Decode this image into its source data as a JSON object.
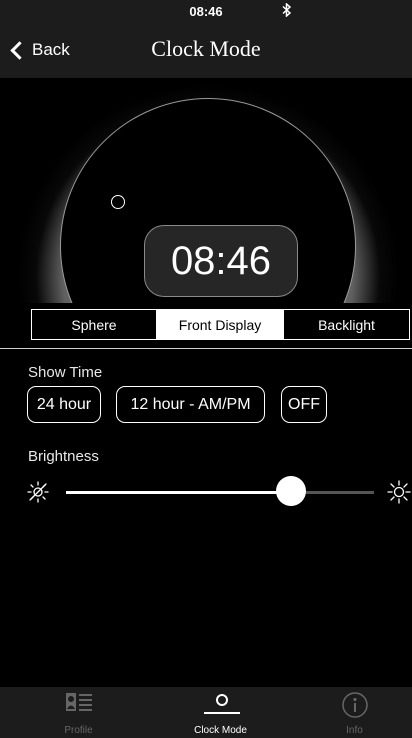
{
  "status_bar": {
    "time": "08:46",
    "bluetooth_icon": "bluetooth-icon"
  },
  "nav": {
    "back_label": "Back",
    "title": "Clock Mode"
  },
  "preview": {
    "time": "08:46"
  },
  "segments": [
    {
      "label": "Sphere",
      "selected": false
    },
    {
      "label": "Front Display",
      "selected": true
    },
    {
      "label": "Backlight",
      "selected": false
    }
  ],
  "show_time": {
    "label": "Show Time",
    "options": [
      {
        "label": "24 hour"
      },
      {
        "label": "12 hour - AM/PM"
      },
      {
        "label": "OFF"
      }
    ]
  },
  "brightness": {
    "label": "Brightness",
    "value_fraction": 0.73
  },
  "tabs": [
    {
      "label": "Profile",
      "icon": "profile-icon",
      "active": false
    },
    {
      "label": "Clock Mode",
      "icon": "clock-mode-icon",
      "active": true
    },
    {
      "label": "Info",
      "icon": "info-icon",
      "active": false
    }
  ],
  "colors": {
    "background": "#000000",
    "bar": "#1c1c1c",
    "active_tab": "#ffffff",
    "inactive_tab": "#666666"
  }
}
